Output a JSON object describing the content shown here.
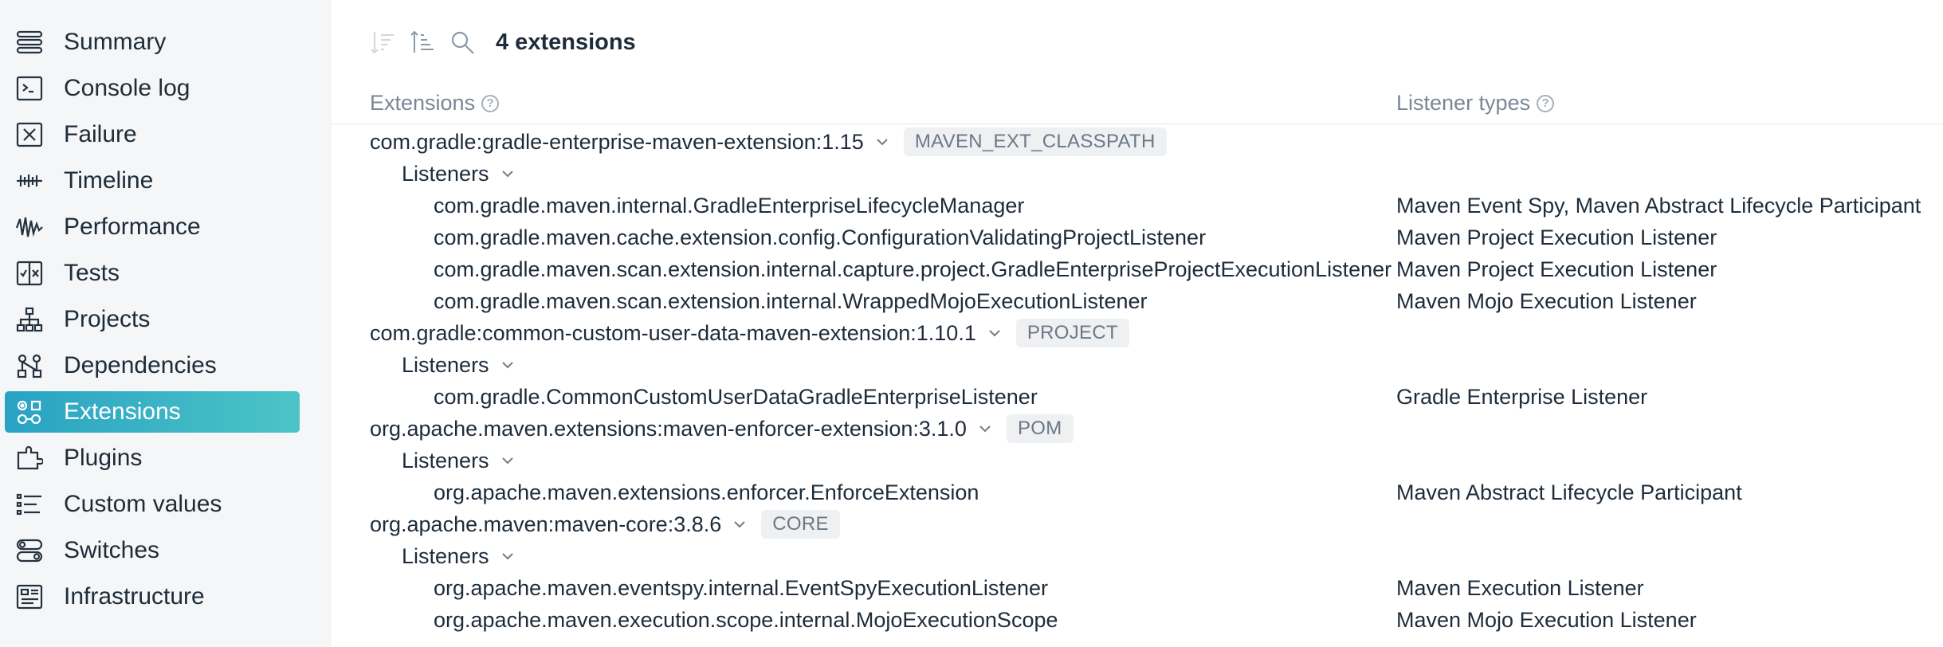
{
  "sidebar": {
    "items": [
      {
        "label": "Summary",
        "icon": "summary-icon",
        "active": false
      },
      {
        "label": "Console log",
        "icon": "console-icon",
        "active": false
      },
      {
        "label": "Failure",
        "icon": "failure-icon",
        "active": false
      },
      {
        "label": "Timeline",
        "icon": "timeline-icon",
        "active": false
      },
      {
        "label": "Performance",
        "icon": "performance-icon",
        "active": false
      },
      {
        "label": "Tests",
        "icon": "tests-icon",
        "active": false
      },
      {
        "label": "Projects",
        "icon": "projects-icon",
        "active": false
      },
      {
        "label": "Dependencies",
        "icon": "dependencies-icon",
        "active": false
      },
      {
        "label": "Extensions",
        "icon": "extensions-icon",
        "active": true
      },
      {
        "label": "Plugins",
        "icon": "plugins-icon",
        "active": false
      },
      {
        "label": "Custom values",
        "icon": "custom-values-icon",
        "active": false
      },
      {
        "label": "Switches",
        "icon": "switches-icon",
        "active": false
      },
      {
        "label": "Infrastructure",
        "icon": "infrastructure-icon",
        "active": false
      }
    ],
    "active_color": "#36acc5"
  },
  "toolbar": {
    "count_label": "4 extensions"
  },
  "table": {
    "headers": {
      "extensions": "Extensions",
      "listener_types": "Listener types"
    },
    "extensions": [
      {
        "name": "com.gradle:gradle-enterprise-maven-extension:1.15",
        "badge": "MAVEN_EXT_CLASSPATH",
        "listeners_label": "Listeners",
        "listeners": [
          {
            "name": "com.gradle.maven.internal.GradleEnterpriseLifecycleManager",
            "types": "Maven Event Spy, Maven Abstract Lifecycle Participant"
          },
          {
            "name": "com.gradle.maven.cache.extension.config.ConfigurationValidatingProjectListener",
            "types": "Maven Project Execution Listener"
          },
          {
            "name": "com.gradle.maven.scan.extension.internal.capture.project.GradleEnterpriseProjectExecutionListener",
            "types": "Maven Project Execution Listener"
          },
          {
            "name": "com.gradle.maven.scan.extension.internal.WrappedMojoExecutionListener",
            "types": "Maven Mojo Execution Listener"
          }
        ]
      },
      {
        "name": "com.gradle:common-custom-user-data-maven-extension:1.10.1",
        "badge": "PROJECT",
        "listeners_label": "Listeners",
        "listeners": [
          {
            "name": "com.gradle.CommonCustomUserDataGradleEnterpriseListener",
            "types": "Gradle Enterprise Listener"
          }
        ]
      },
      {
        "name": "org.apache.maven.extensions:maven-enforcer-extension:3.1.0",
        "badge": "POM",
        "listeners_label": "Listeners",
        "listeners": [
          {
            "name": "org.apache.maven.extensions.enforcer.EnforceExtension",
            "types": "Maven Abstract Lifecycle Participant"
          }
        ]
      },
      {
        "name": "org.apache.maven:maven-core:3.8.6",
        "badge": "CORE",
        "listeners_label": "Listeners",
        "listeners": [
          {
            "name": "org.apache.maven.eventspy.internal.EventSpyExecutionListener",
            "types": "Maven Execution Listener"
          },
          {
            "name": "org.apache.maven.execution.scope.internal.MojoExecutionScope",
            "types": "Maven Mojo Execution Listener"
          }
        ]
      }
    ]
  }
}
